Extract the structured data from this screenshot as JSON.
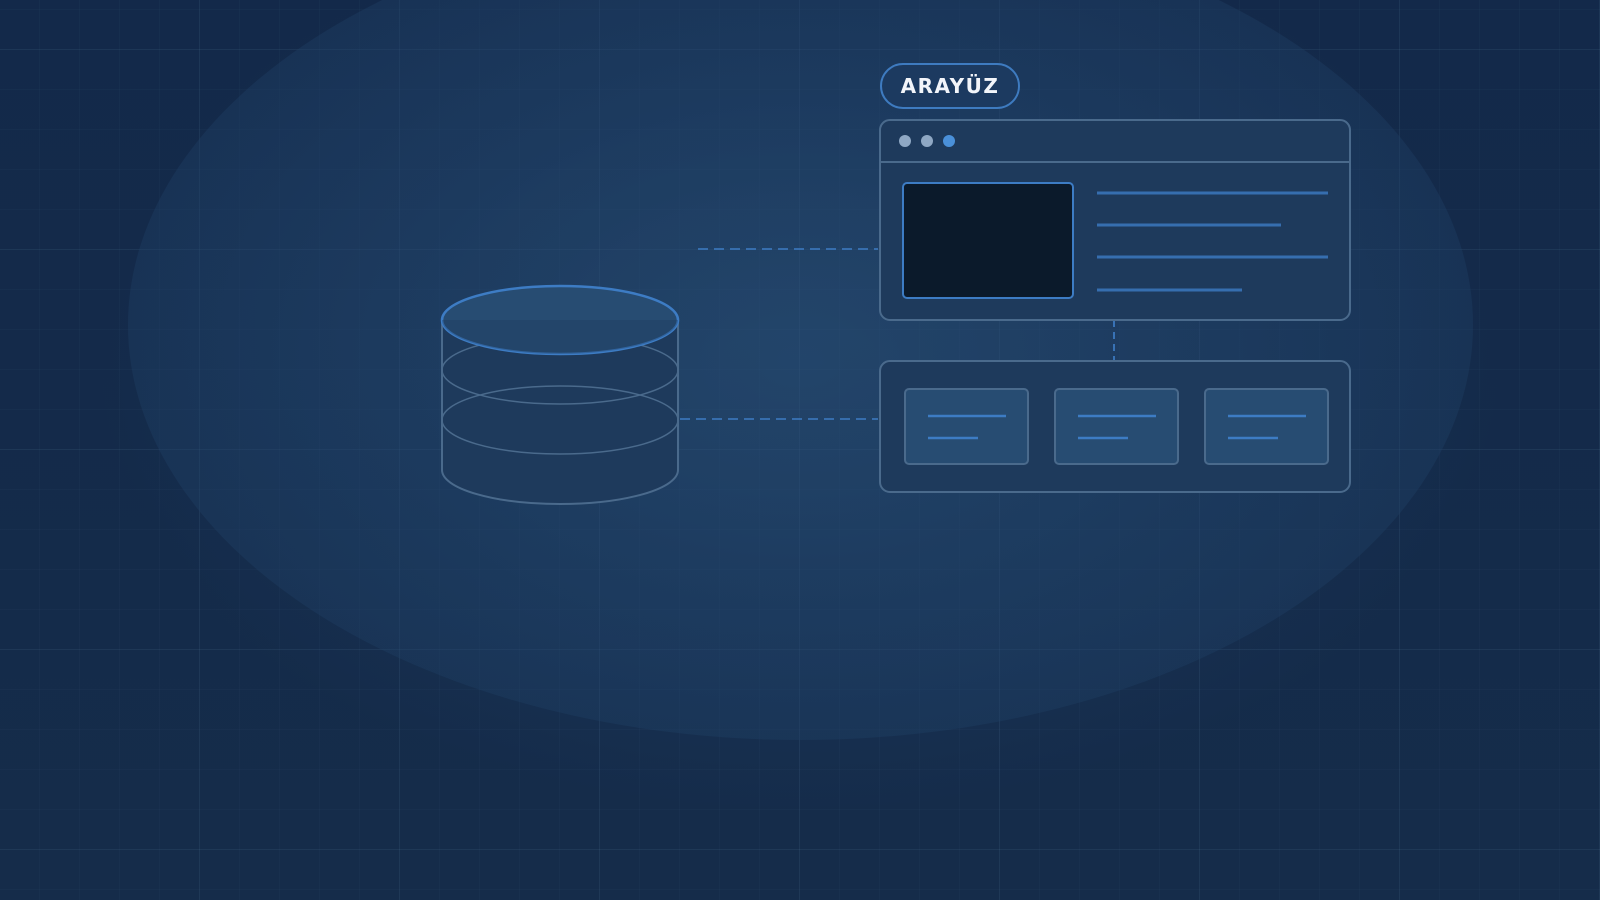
{
  "diagram": {
    "interface_label": "ARAYÜZ",
    "nodes": [
      {
        "id": "database",
        "icon": "database-icon"
      },
      {
        "id": "interface-window",
        "icon": "browser-window-icon"
      },
      {
        "id": "component-panel",
        "icon": "card-grid-icon"
      }
    ],
    "edges": [
      {
        "from": "database",
        "to": "component-panel",
        "style": "dashed"
      },
      {
        "from": "interface-window",
        "to": "component-panel",
        "style": "dashed"
      },
      {
        "from": "database",
        "to": "interface-window",
        "style": "dashed"
      }
    ]
  },
  "colors": {
    "background": "#142a46",
    "panel": "#1e3a5c",
    "panel_border": "#4a6a8c",
    "accent": "#3d7cc4",
    "dot_active": "#4a90d9",
    "dot_idle": "#8fa8c4",
    "screen": "#0b1a2b",
    "label_text": "#f2f5fa"
  }
}
